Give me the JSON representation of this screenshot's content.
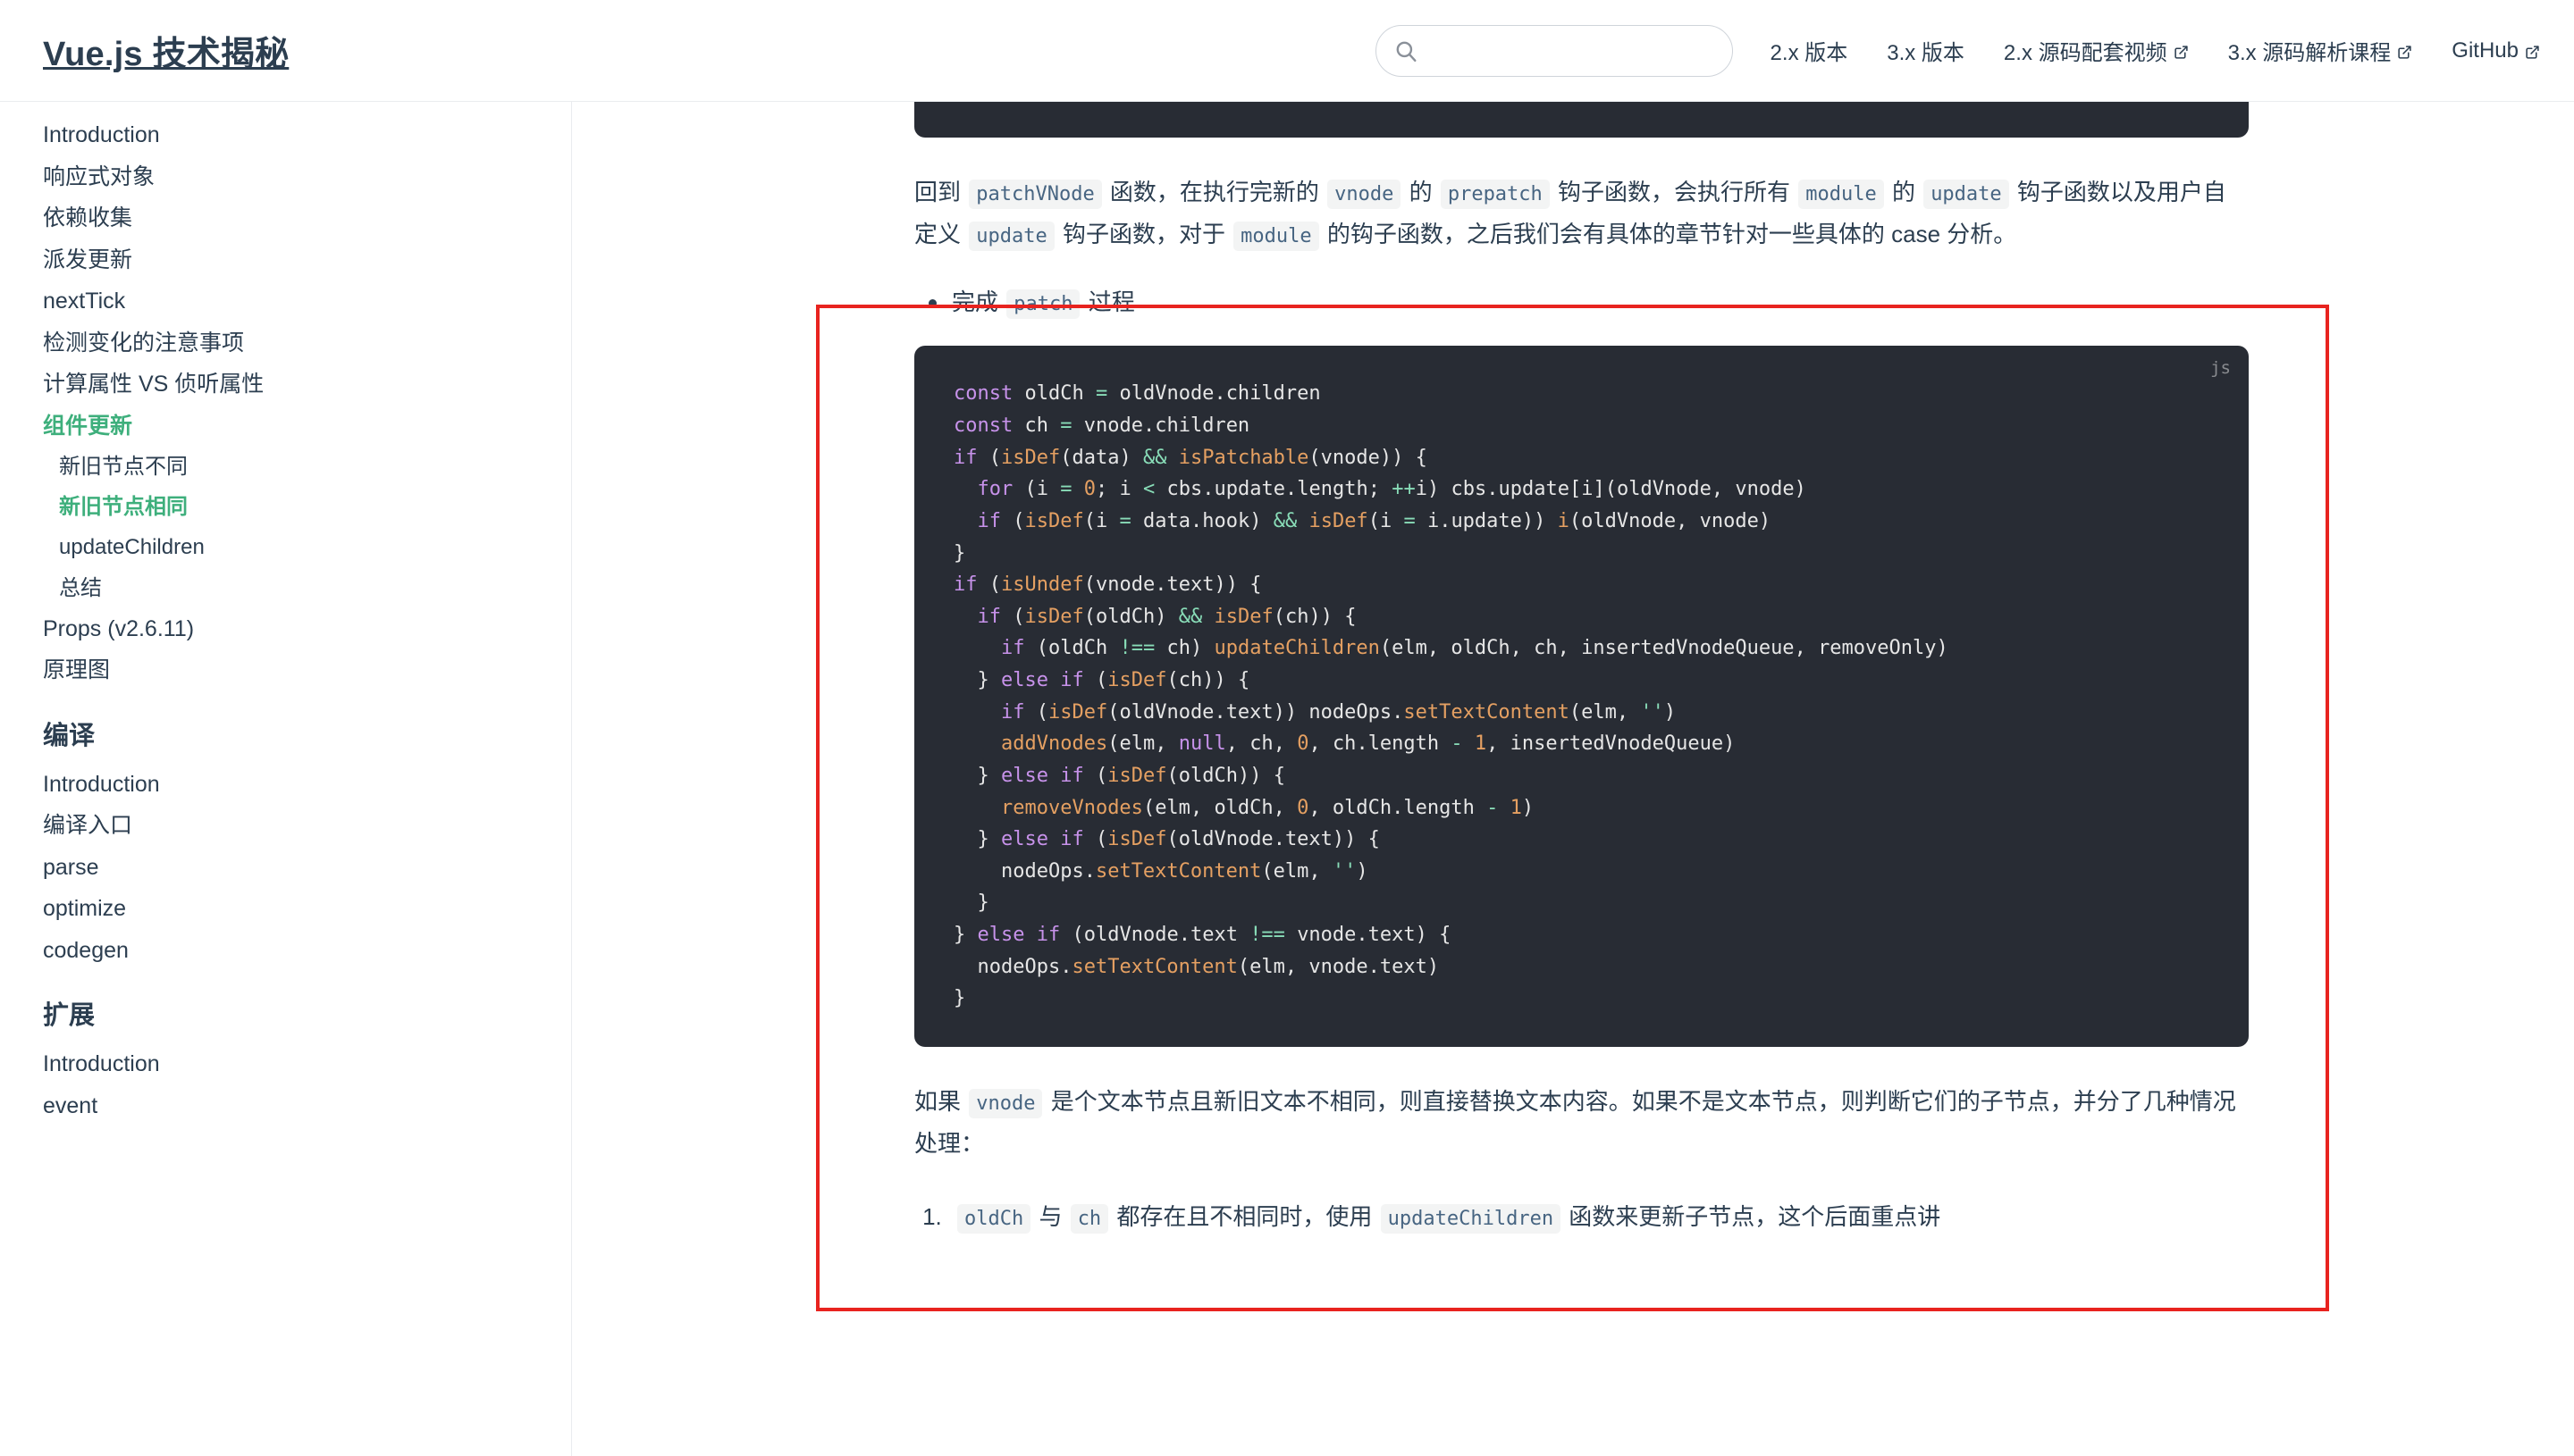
{
  "navbar": {
    "site_title": "Vue.js 技术揭秘",
    "search": {
      "placeholder": "",
      "value": "",
      "icon": "search-icon"
    },
    "links": [
      {
        "label": "2.x 版本",
        "external": false
      },
      {
        "label": "3.x 版本",
        "external": false
      },
      {
        "label": "2.x 源码配套视频",
        "external": true
      },
      {
        "label": "3.x 源码解析课程",
        "external": true
      },
      {
        "label": "GitHub",
        "external": true
      }
    ]
  },
  "sidebar": {
    "top_items": [
      {
        "label": "Introduction",
        "active": false
      },
      {
        "label": "响应式对象",
        "active": false
      },
      {
        "label": "依赖收集",
        "active": false
      },
      {
        "label": "派发更新",
        "active": false
      },
      {
        "label": "nextTick",
        "active": false
      },
      {
        "label": "检测变化的注意事项",
        "active": false
      },
      {
        "label": "计算属性 VS 侦听属性",
        "active": false
      },
      {
        "label": "组件更新",
        "active": true
      }
    ],
    "sub_items": [
      {
        "label": "新旧节点不同",
        "active": false
      },
      {
        "label": "新旧节点相同",
        "active": true
      },
      {
        "label": "updateChildren",
        "active": false
      },
      {
        "label": "总结",
        "active": false
      }
    ],
    "after_sub_items": [
      {
        "label": "Props (v2.6.11)",
        "active": false
      },
      {
        "label": "原理图",
        "active": false
      }
    ],
    "groups": [
      {
        "title": "编译",
        "items": [
          {
            "label": "Introduction",
            "active": false
          },
          {
            "label": "编译入口",
            "active": false
          },
          {
            "label": "parse",
            "active": false
          },
          {
            "label": "optimize",
            "active": false
          },
          {
            "label": "codegen",
            "active": false
          }
        ]
      },
      {
        "title": "扩展",
        "items": [
          {
            "label": "Introduction",
            "active": false
          },
          {
            "label": "event",
            "active": false
          }
        ]
      }
    ]
  },
  "content": {
    "paragraph_1": {
      "segments": [
        {
          "type": "text",
          "text": "回到 "
        },
        {
          "type": "code",
          "text": "patchVNode"
        },
        {
          "type": "text",
          "text": " 函数，在执行完新的 "
        },
        {
          "type": "code",
          "text": "vnode"
        },
        {
          "type": "text",
          "text": " 的 "
        },
        {
          "type": "code",
          "text": "prepatch"
        },
        {
          "type": "text",
          "text": " 钩子函数，会执行所有 "
        },
        {
          "type": "code",
          "text": "module"
        },
        {
          "type": "text",
          "text": " 的 "
        },
        {
          "type": "code",
          "text": "update"
        },
        {
          "type": "text",
          "text": " 钩子函数以及用户自定义 "
        },
        {
          "type": "code",
          "text": "update"
        },
        {
          "type": "text",
          "text": " 钩子函数，对于 "
        },
        {
          "type": "code",
          "text": "module"
        },
        {
          "type": "text",
          "text": " 的钩子函数，之后我们会有具体的章节针对一些具体的 case 分析。"
        }
      ]
    },
    "bullet_1": {
      "segments": [
        {
          "type": "text",
          "text": "完成 "
        },
        {
          "type": "code",
          "text": "patch"
        },
        {
          "type": "text",
          "text": " 过程"
        }
      ]
    },
    "code_block": {
      "language_label": "js",
      "lines": [
        "const oldCh = oldVnode.children",
        "const ch = vnode.children",
        "if (isDef(data) && isPatchable(vnode)) {",
        "  for (i = 0; i < cbs.update.length; ++i) cbs.update[i](oldVnode, vnode)",
        "  if (isDef(i = data.hook) && isDef(i = i.update)) i(oldVnode, vnode)",
        "}",
        "if (isUndef(vnode.text)) {",
        "  if (isDef(oldCh) && isDef(ch)) {",
        "    if (oldCh !== ch) updateChildren(elm, oldCh, ch, insertedVnodeQueue, removeOnly)",
        "  } else if (isDef(ch)) {",
        "    if (isDef(oldVnode.text)) nodeOps.setTextContent(elm, '')",
        "    addVnodes(elm, null, ch, 0, ch.length - 1, insertedVnodeQueue)",
        "  } else if (isDef(oldCh)) {",
        "    removeVnodes(elm, oldCh, 0, oldCh.length - 1)",
        "  } else if (isDef(oldVnode.text)) {",
        "    nodeOps.setTextContent(elm, '')",
        "  }",
        "} else if (oldVnode.text !== vnode.text) {",
        "  nodeOps.setTextContent(elm, vnode.text)",
        "}"
      ]
    },
    "paragraph_2": {
      "segments": [
        {
          "type": "text",
          "text": "如果 "
        },
        {
          "type": "code",
          "text": "vnode"
        },
        {
          "type": "text",
          "text": " 是个文本节点且新旧文本不相同，则直接替换文本内容。如果不是文本节点，则判断它们的子节点，并分了几种情况处理："
        }
      ]
    },
    "list_item_1": {
      "segments": [
        {
          "type": "code",
          "text": "oldCh"
        },
        {
          "type": "text",
          "text": " 与 "
        },
        {
          "type": "code",
          "text": "ch"
        },
        {
          "type": "text",
          "text": " 都存在且不相同时，使用 "
        },
        {
          "type": "code",
          "text": "updateChildren"
        },
        {
          "type": "text",
          "text": " 函数来更新子节点，这个后面重点讲"
        }
      ]
    }
  },
  "annotation": {
    "type": "red-rectangle-highlight",
    "color": "#e8231f"
  },
  "colors": {
    "accent_green": "#3eaf7c",
    "text": "#2c3e50",
    "code_bg": "#282c34",
    "border": "#eaecef",
    "annotation_red": "#e8231f"
  }
}
